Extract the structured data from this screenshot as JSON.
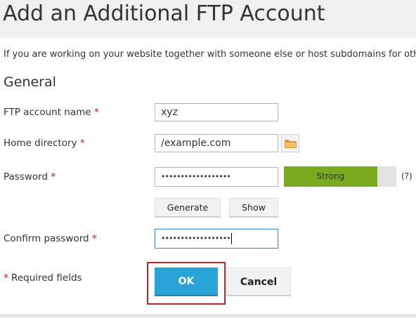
{
  "page": {
    "title": "Add an Additional FTP Account",
    "intro": "If you are working on your website together with someone else or host subdomains for oth"
  },
  "section": {
    "title": "General"
  },
  "form": {
    "required_mark": "*",
    "ftp_name": {
      "label": "FTP account name",
      "value": "xyz"
    },
    "home_dir": {
      "label": "Home directory",
      "value": "/example.com",
      "browse_icon": "folder-icon"
    },
    "password": {
      "label": "Password",
      "masked_value": "••••••••••••••••••",
      "strength": "Strong",
      "strength_fraction": 0.83,
      "help": "(?)"
    },
    "generate_label": "Generate",
    "show_label": "Show",
    "confirm": {
      "label": "Confirm password",
      "masked_value": "••••••••••••••••••"
    },
    "required_note": "Required fields"
  },
  "actions": {
    "ok_label": "OK",
    "cancel_label": "Cancel"
  },
  "colors": {
    "accent": "#29a3d7",
    "strength": "#7aab1f",
    "required": "#c8102e",
    "highlight": "#c0272d"
  }
}
